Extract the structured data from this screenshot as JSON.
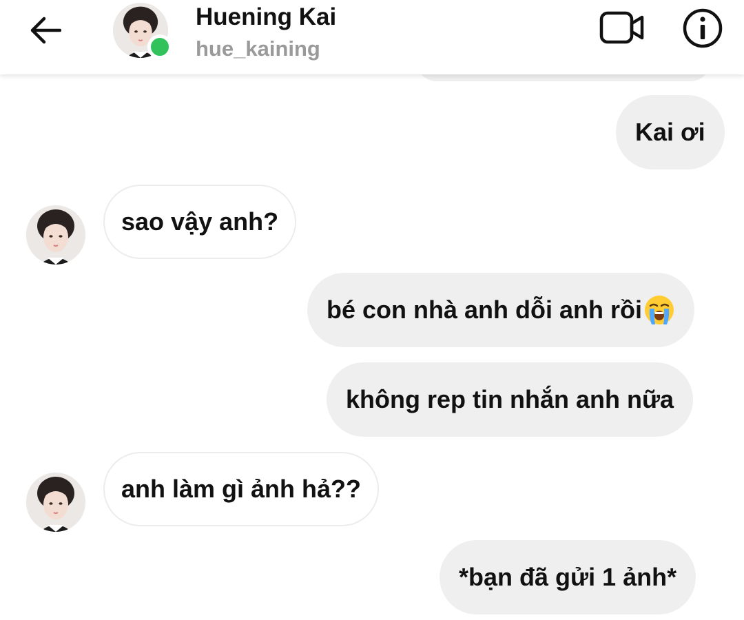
{
  "header": {
    "name": "Huening Kai",
    "username": "hue_kaining",
    "online": true
  },
  "icons": {
    "back": "arrow-left-icon",
    "video": "video-camera-icon",
    "info": "info-icon",
    "emoji": "loudly-crying-face-emoji"
  },
  "colors": {
    "online_dot": "#31c25b",
    "outgoing_bubble": "#efefef",
    "incoming_border": "#ececec",
    "username": "#9a9a9a"
  },
  "messages": [
    {
      "direction": "out",
      "text": "Kai ơi"
    },
    {
      "direction": "in",
      "text": "sao vậy anh?"
    },
    {
      "direction": "out",
      "text": "bé con nhà anh dỗi anh rồi"
    },
    {
      "direction": "out",
      "text": "không rep tin nhắn anh nữa"
    },
    {
      "direction": "in",
      "text": "anh làm gì ảnh hả??"
    },
    {
      "direction": "out",
      "text": "*bạn đã gửi 1 ảnh*"
    }
  ]
}
